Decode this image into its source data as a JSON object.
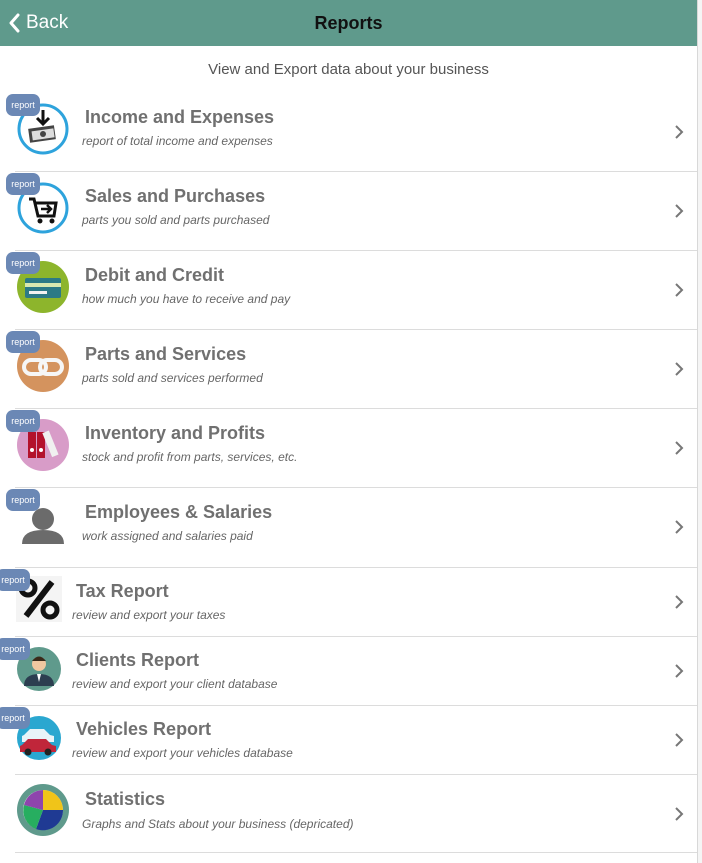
{
  "header": {
    "title": "Reports",
    "back_label": "Back"
  },
  "subtitle": "View and Export data about your business",
  "badge_label": "report",
  "items": [
    {
      "title": "Income and Expenses",
      "desc": "report of total income and expenses",
      "icon": "money-icon"
    },
    {
      "title": "Sales and Purchases",
      "desc": "parts you sold and parts purchased",
      "icon": "cart-icon"
    },
    {
      "title": "Debit and Credit",
      "desc": "how much you have to receive and pay",
      "icon": "credit-card-icon"
    },
    {
      "title": "Parts and Services",
      "desc": "parts sold and services performed",
      "icon": "link-icon"
    },
    {
      "title": "Inventory and Profits",
      "desc": "stock and profit from parts, services, etc.",
      "icon": "binders-icon"
    },
    {
      "title": "Employees & Salaries",
      "desc": "work assigned and salaries paid",
      "icon": "person-icon"
    },
    {
      "title": "Tax Report",
      "desc": "review and export your taxes",
      "icon": "percent-icon"
    },
    {
      "title": "Clients Report",
      "desc": "review and export your client database",
      "icon": "client-icon"
    },
    {
      "title": "Vehicles Report",
      "desc": "review and export your vehicles database",
      "icon": "car-icon"
    },
    {
      "title": "Statistics",
      "desc": "Graphs and Stats about your business (depricated)",
      "icon": "pie-chart-icon"
    }
  ]
}
